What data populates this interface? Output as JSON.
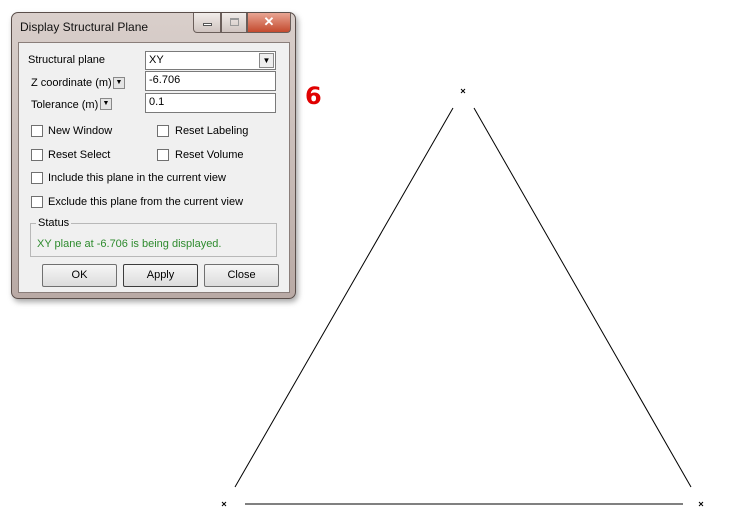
{
  "dialog": {
    "title": "Display Structural Plane",
    "structural_plane_label": "Structural plane",
    "structural_plane_value": "XY",
    "z_coordinate_label": "Z coordinate (m)",
    "z_coordinate_value": "-6.706",
    "tolerance_label": "Tolerance (m)",
    "tolerance_value": "0.1",
    "checkboxes": [
      {
        "label": "New Window",
        "checked": false
      },
      {
        "label": "Reset Labeling",
        "checked": false
      },
      {
        "label": "Reset Select",
        "checked": false
      },
      {
        "label": "Reset Volume",
        "checked": false
      },
      {
        "label": "Include this plane in the current view",
        "checked": false
      },
      {
        "label": "Exclude this plane from the current view",
        "checked": false
      }
    ],
    "status_label": "Status",
    "status_text": "XY plane at -6.706 is being displayed.",
    "status_color": "#2e8b2e",
    "buttons": {
      "ok": "OK",
      "apply": "Apply",
      "close": "Close"
    }
  },
  "annotation": {
    "text": "6",
    "color": "#e00000"
  }
}
